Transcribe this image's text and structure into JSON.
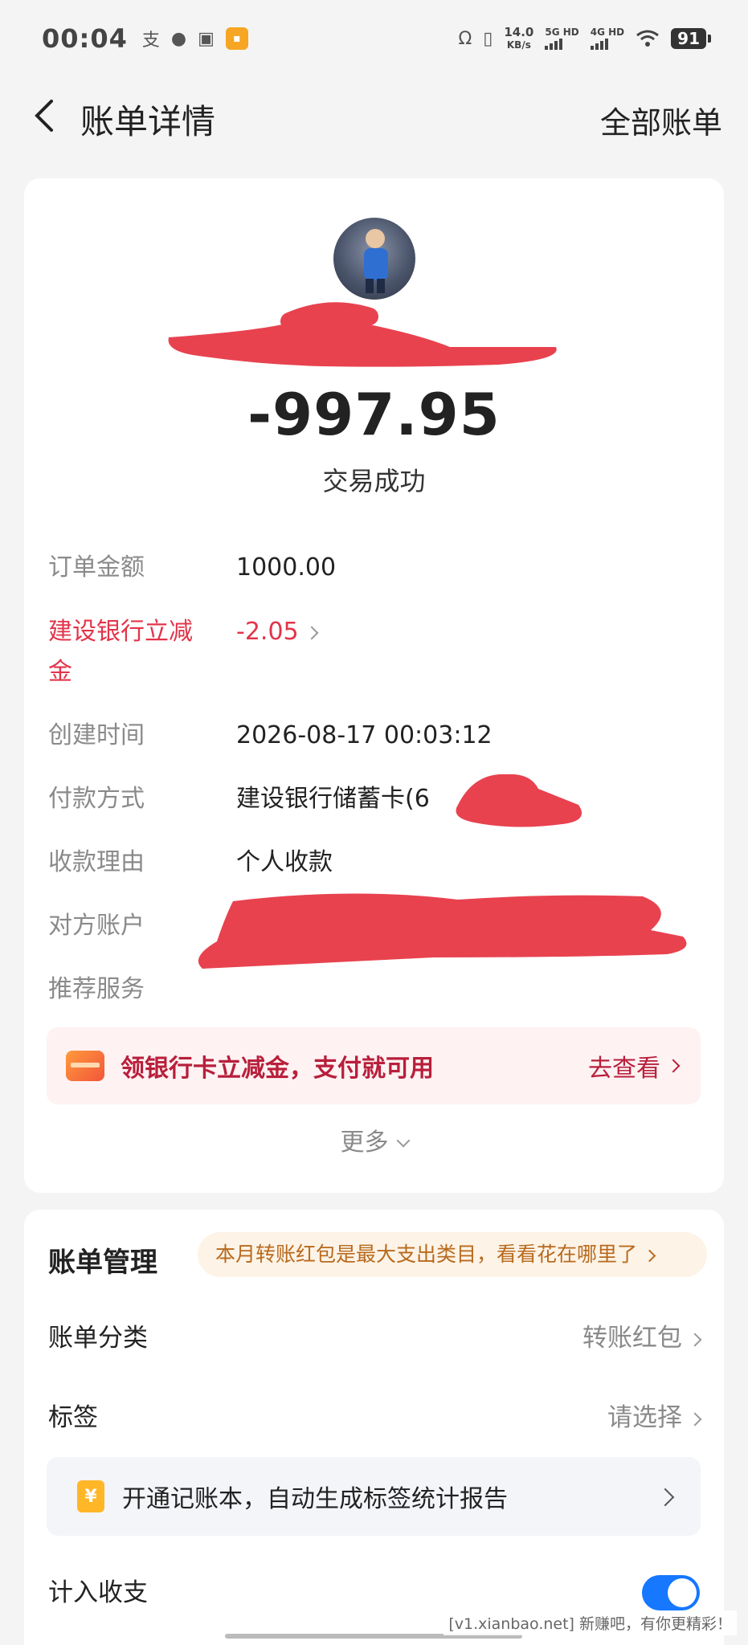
{
  "status_bar": {
    "time": "00:04",
    "net_speed_top": "14.0",
    "net_speed_bottom": "KB/s",
    "sig1_label": "5G HD",
    "sig2_label": "4G HD",
    "battery": "91"
  },
  "nav": {
    "title": "账单详情",
    "right_action": "全部账单"
  },
  "summary": {
    "amount": "-997.95",
    "status": "交易成功"
  },
  "details": [
    {
      "label": "订单金额",
      "value": "1000.00"
    },
    {
      "label": "建设银行立减",
      "label2": "金",
      "value": "-2.05"
    },
    {
      "label": "创建时间",
      "value": "2026-08-17 00:03:12"
    },
    {
      "label": "付款方式",
      "value": "建设银行储蓄卡(6"
    },
    {
      "label": "收款理由",
      "value": "个人收款"
    },
    {
      "label": "对方账户",
      "value": ""
    },
    {
      "label": "推荐服务",
      "value": ""
    }
  ],
  "promo": {
    "text": "领银行卡立减金，支付就可用",
    "link": "去查看"
  },
  "more": "更多",
  "bill_mgmt": {
    "title": "账单管理",
    "tip": "本月转账红包是最大支出类目，看看花在哪里了",
    "category_label": "账单分类",
    "category_value": "转账红包",
    "tag_label": "标签",
    "tag_value": "请选择",
    "notebook_icon": "¥",
    "notebook_text": "开通记账本，自动生成标签统计报告",
    "include_label": "计入收支",
    "include_on": true
  },
  "watermark": "[v1.xianbao.net] 新赚吧，有你更精彩！",
  "colors": {
    "accent_red": "#e2344a",
    "toggle_blue": "#1677ff",
    "redaction": "#e8424f"
  }
}
